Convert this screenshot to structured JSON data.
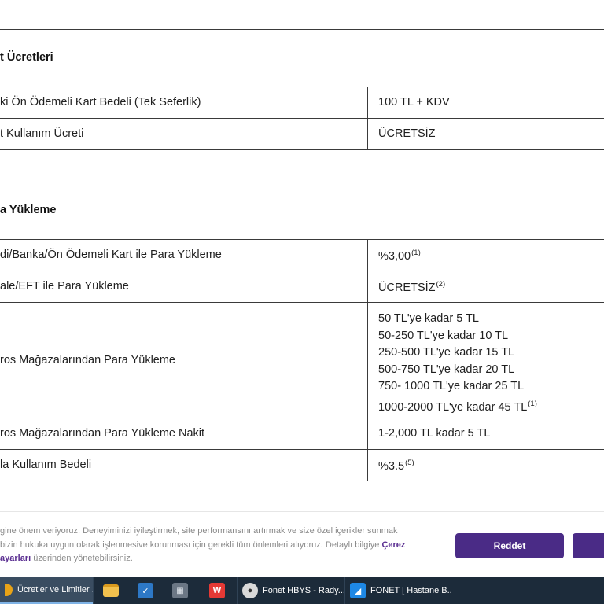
{
  "sections": [
    {
      "title": "t Ücretleri"
    },
    {
      "title": "a Yükleme"
    }
  ],
  "rows": [
    {
      "label": "ki Ön Ödemeli Kart Bedeli (Tek Seferlik)",
      "value": "100 TL + KDV"
    },
    {
      "label": "t Kullanım Ücreti",
      "value": "ÜCRETSİZ"
    },
    {
      "label": "di/Banka/Ön Ödemeli Kart ile Para Yükleme",
      "value": "%3,00",
      "note": "(1)"
    },
    {
      "label": "ale/EFT ile Para Yükleme",
      "value": "ÜCRETSİZ",
      "note": "(2)"
    },
    {
      "label": "ros Mağazalarından Para Yükleme",
      "value_lines": [
        "50 TL'ye kadar 5 TL",
        "50-250 TL'ye kadar 10 TL",
        "250-500 TL'ye kadar 15 TL",
        "500-750 TL'ye kadar 20 TL",
        "750- 1000 TL'ye kadar 25 TL",
        "1000-2000 TL'ye kadar 45 TL"
      ],
      "note": "(1)"
    },
    {
      "label": "ros Mağazalarından Para Yükleme Nakit",
      "value": "1-2,000 TL kadar 5 TL"
    },
    {
      "label": "la Kullanım Bedeli",
      "value": "%3.5",
      "note": "(5)"
    }
  ],
  "cookie": {
    "line1": "gine önem veriyoruz. Deneyiminizi iyileştirmek, site performansını artırmak ve size özel içerikler sunmak",
    "line2_text": "bizin hukuka uygun olarak işlenmesive korunması için gerekli tüm önlemleri alıyoruz. Detaylı bilgiye",
    "line2_link": "Çerez",
    "line3_link": "ayarları",
    "line3_text": "üzerinden yönetebilirsiniz.",
    "reject_label": "Reddet",
    "accept_label": ""
  },
  "taskbar": {
    "items": [
      {
        "icon": "browser-tab-icon",
        "label": "Ücretler ve Limitler ...",
        "active": true
      },
      {
        "icon": "file-explorer-icon",
        "label": ""
      },
      {
        "icon": "app-check-icon",
        "label": ""
      },
      {
        "icon": "remote-desktop-icon",
        "label": ""
      },
      {
        "icon": "wps-office-icon",
        "label": ""
      },
      {
        "icon": "fonet-hbys-icon",
        "label": "Fonet HBYS - Rady..."
      },
      {
        "icon": "fonet-hastane-icon",
        "label": "FONET [ Hastane B..."
      }
    ]
  },
  "colors": {
    "accent": "#4a2b86",
    "taskbar": "#1c2b3a",
    "table_border": "#3a3a3a"
  }
}
